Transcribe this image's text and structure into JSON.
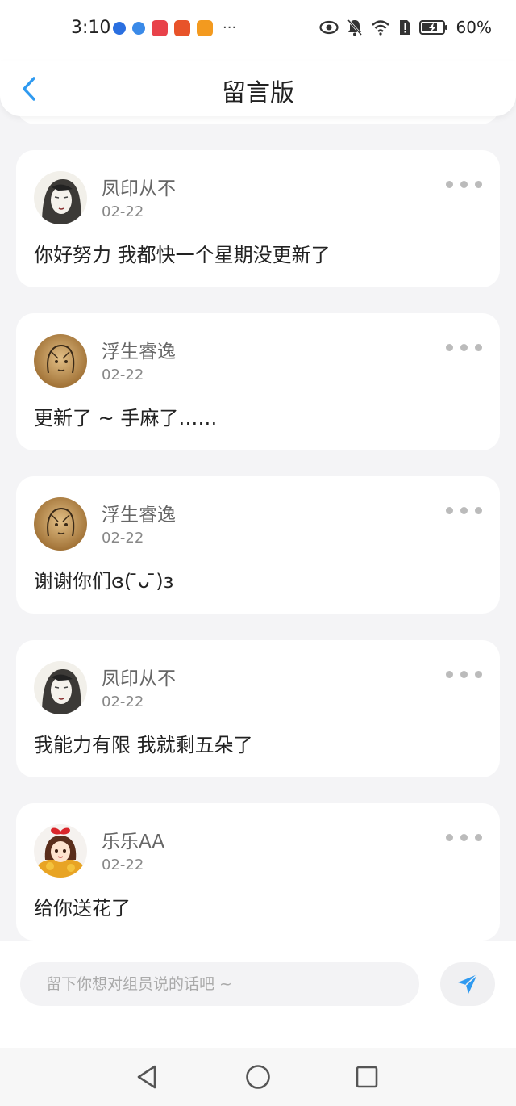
{
  "status_bar": {
    "time": "3:10",
    "more": "···",
    "battery": "60%",
    "app_icon_colors": [
      "#2a6fe0",
      "#3a8ae8",
      "#e8424a",
      "#e8532a",
      "#f39a1f"
    ]
  },
  "header": {
    "title": "留言版",
    "back_icon": "chevron-left-icon",
    "accent_color": "#2f9af0"
  },
  "messages": [
    {
      "name": "凤印从不",
      "date": "02-22",
      "text": "你好努力 我都快一个星期没更新了",
      "avatar": "sketch-girl-avatar"
    },
    {
      "name": "浮生睿逸",
      "date": "02-22",
      "text": "更新了 ~ 手麻了……",
      "avatar": "sepia-sketch-avatar"
    },
    {
      "name": "浮生睿逸",
      "date": "02-22",
      "text": "谢谢你们ɞ( ̄ᴗ ̄)ɜ",
      "avatar": "sepia-sketch-avatar"
    },
    {
      "name": "凤印从不",
      "date": "02-22",
      "text": "我能力有限 我就剩五朵了",
      "avatar": "sketch-girl-avatar"
    },
    {
      "name": "乐乐AA",
      "date": "02-22",
      "text": "给你送花了",
      "avatar": "cartoon-girl-avatar"
    }
  ],
  "composer": {
    "placeholder": "留下你想对组员说的话吧 ~",
    "send_icon": "paper-plane-icon"
  },
  "nav_bar": {
    "icons": [
      "back-triangle-icon",
      "home-circle-icon",
      "recents-square-icon"
    ]
  }
}
